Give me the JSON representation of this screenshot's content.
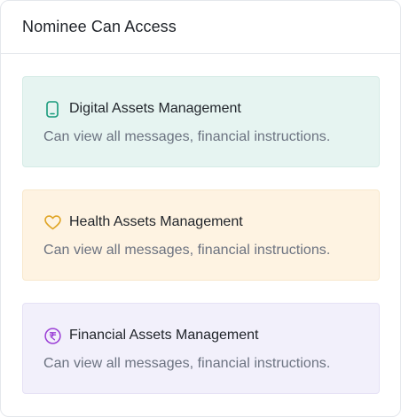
{
  "header": {
    "title": "Nominee Can Access"
  },
  "items": [
    {
      "title": "Digital Assets Management",
      "description": "Can view all messages, financial instructions.",
      "icon": "phone-icon",
      "accent": "#16997a",
      "background": "#e6f4f1"
    },
    {
      "title": "Health Assets Management",
      "description": "Can view all messages, financial instructions.",
      "icon": "heart-icon",
      "accent": "#e0a526",
      "background": "#fef3e2"
    },
    {
      "title": "Financial Assets Management",
      "description": "Can view all messages, financial instructions.",
      "icon": "rupee-icon",
      "accent": "#9b3fd6",
      "background": "#f2f0fb"
    }
  ]
}
